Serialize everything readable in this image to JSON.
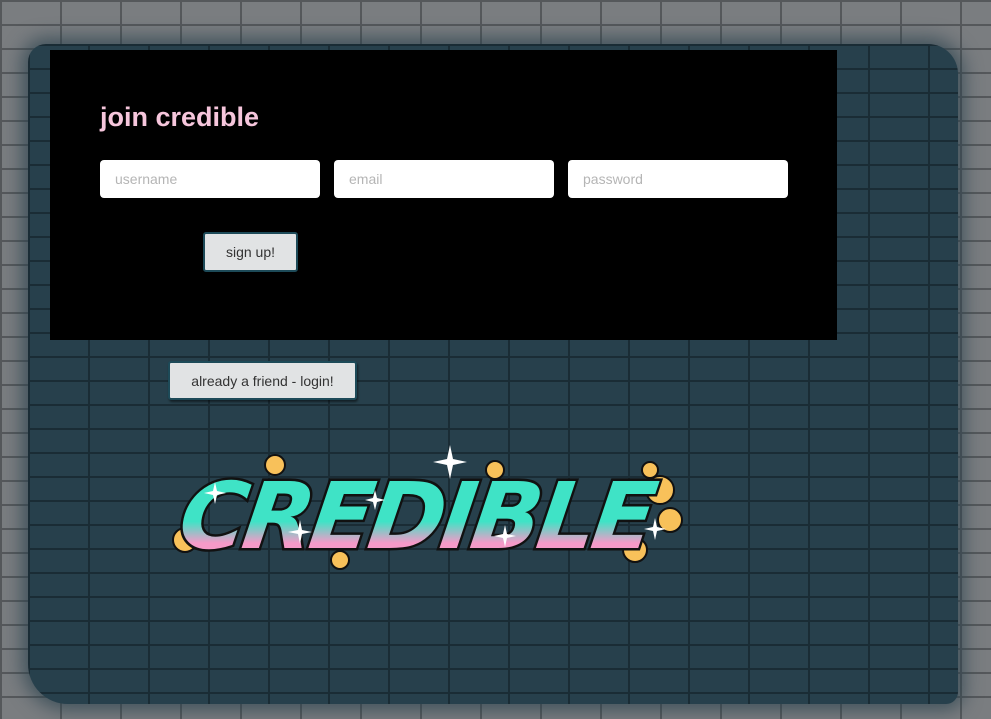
{
  "signup": {
    "title": "join credible",
    "username_placeholder": "username",
    "email_placeholder": "email",
    "password_placeholder": "password",
    "signup_label": "sign up!"
  },
  "login": {
    "label": "already a friend - login!"
  },
  "logo": {
    "text": "CREDIBLE",
    "colors": {
      "top": "#3fe3c6",
      "bottom": "#f59ac8",
      "outline": "#111111",
      "bubbles": "#f8c15a"
    }
  },
  "colors": {
    "title": "#f6c6dc",
    "panel": "#000000",
    "wall_paint": "#27404c",
    "button_border": "#1d4a58"
  }
}
